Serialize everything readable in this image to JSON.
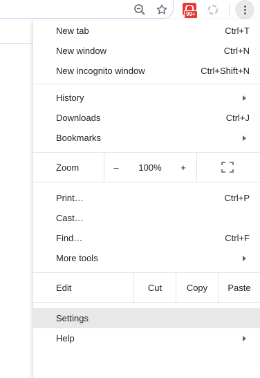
{
  "toolbar": {
    "zoom_icon": "zoom-out-magnifier-icon",
    "star_icon": "bookmark-star-icon",
    "extension_badge": "99+",
    "menu_icon": "three-dots-vertical-icon"
  },
  "menu": {
    "new_tab": {
      "label": "New tab",
      "shortcut": "Ctrl+T"
    },
    "new_window": {
      "label": "New window",
      "shortcut": "Ctrl+N"
    },
    "new_incognito": {
      "label": "New incognito window",
      "shortcut": "Ctrl+Shift+N"
    },
    "history": {
      "label": "History"
    },
    "downloads": {
      "label": "Downloads",
      "shortcut": "Ctrl+J"
    },
    "bookmarks": {
      "label": "Bookmarks"
    },
    "zoom": {
      "label": "Zoom",
      "minus": "–",
      "level": "100%",
      "plus": "+"
    },
    "print": {
      "label": "Print…",
      "shortcut": "Ctrl+P"
    },
    "cast": {
      "label": "Cast…"
    },
    "find": {
      "label": "Find…",
      "shortcut": "Ctrl+F"
    },
    "more_tools": {
      "label": "More tools"
    },
    "edit": {
      "label": "Edit",
      "cut": "Cut",
      "copy": "Copy",
      "paste": "Paste"
    },
    "settings": {
      "label": "Settings"
    },
    "help": {
      "label": "Help"
    }
  },
  "colors": {
    "highlight": "#e8e8e8",
    "badge": "#e53935",
    "separator": "#e3e3e3"
  }
}
